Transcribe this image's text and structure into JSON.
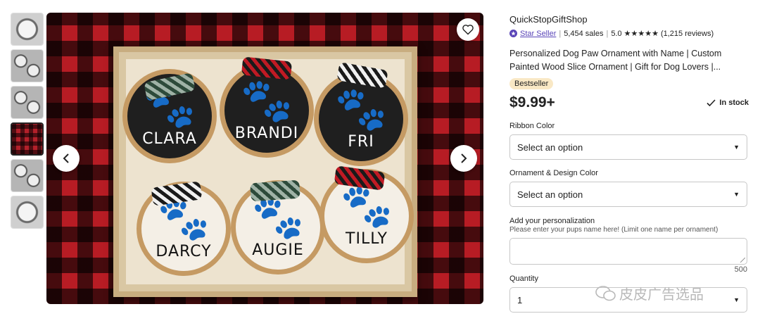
{
  "gallery": {
    "thumbnails": [
      {
        "kind": "grey",
        "active": false
      },
      {
        "kind": "silver",
        "active": false
      },
      {
        "kind": "silver",
        "active": false
      },
      {
        "kind": "plaid",
        "active": true
      },
      {
        "kind": "silver",
        "active": false
      },
      {
        "kind": "grey",
        "active": false
      }
    ],
    "ornaments": [
      {
        "name": "CLARA",
        "style": "dark",
        "bow": "green"
      },
      {
        "name": "BRANDI",
        "style": "dark",
        "bow": "red"
      },
      {
        "name": "FRI",
        "style": "dark",
        "bow": "bw"
      },
      {
        "name": "DARCY",
        "style": "light",
        "bow": "bw"
      },
      {
        "name": "AUGIE",
        "style": "light",
        "bow": "green"
      },
      {
        "name": "TILLY",
        "style": "light",
        "bow": "red"
      }
    ],
    "icons": {
      "favorite": "heart-icon",
      "prev": "chevron-left-icon",
      "next": "chevron-right-icon"
    }
  },
  "listing": {
    "shop_name": "QuickStopGiftShop",
    "star_seller": "Star Seller",
    "sales": "5,454 sales",
    "rating": "5.0",
    "stars": "★★★★★",
    "reviews": "(1,215 reviews)",
    "title": "Personalized Dog Paw Ornament with Name | Custom Painted Wood Slice Ornament | Gift for Dog Lovers |...",
    "badge": "Bestseller",
    "price": "$9.99+",
    "stock": "In stock"
  },
  "form": {
    "ribbon_label": "Ribbon Color",
    "ribbon_value": "Select an option",
    "ornament_label": "Ornament & Design Color",
    "ornament_value": "Select an option",
    "personalization_label": "Add your personalization",
    "personalization_hint": "Please enter your pups name here! (Limit one name per ornament)",
    "personalization_value": "",
    "char_counter": "500",
    "quantity_label": "Quantity",
    "quantity_value": "1"
  },
  "watermark": {
    "text": "皮皮广告选品"
  },
  "colors": {
    "accent": "#5a45b8",
    "badge_bg": "#f9e8c5",
    "plaid_red": "#b71c24"
  }
}
